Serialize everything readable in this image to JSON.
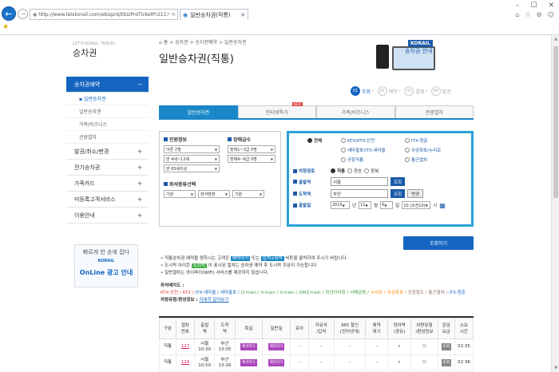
{
  "browser": {
    "url": "http://www.letskorail.com/ebizprd/EbizPrdTicketPr21111...",
    "tab_title": "일반승차권(직통)",
    "back": "←",
    "forward": "→"
  },
  "sidebar": {
    "brand_small": "LET'S KORAIL TRAVEL",
    "title": "승차권",
    "menu": [
      {
        "label": "승차권예약",
        "active": true,
        "toggle": "−"
      },
      {
        "label": "발권/취소/변경",
        "toggle": "+"
      },
      {
        "label": "전기승차권",
        "toggle": "+"
      },
      {
        "label": "가족카드",
        "toggle": "+"
      },
      {
        "label": "미등록고객서비스",
        "toggle": "+"
      },
      {
        "label": "이용안내",
        "toggle": "+"
      }
    ],
    "submenu": [
      "▪ 일반승차권",
      "일반승차권",
      "가족/비즈니스",
      "관광열차"
    ],
    "ad": {
      "line1": "빠르게 한 손에 잡다",
      "logo": "KORAIL",
      "line2": "OnLine 광고 안내"
    }
  },
  "main": {
    "breadcrumb": "⌂  홈  >  승차권  >  승차권예약  >  일반승차권",
    "title": "일반승차권(직통)",
    "promo": {
      "logo": "KORAIL",
      "text": "승차권 안내"
    },
    "steps": [
      {
        "num": "01",
        "label": "조회",
        "active": true
      },
      {
        "num": "02",
        "label": "예약"
      },
      {
        "num": "03",
        "label": "결제"
      },
      {
        "num": "04",
        "label": "발권"
      }
    ],
    "tabs": [
      {
        "label": "일반승차권",
        "active": true
      },
      {
        "label": "인터넷특가",
        "badge": "NEW"
      },
      {
        "label": "가족/비즈니스"
      },
      {
        "label": "관광열차"
      }
    ],
    "passenger": {
      "section": "인원정보",
      "rows": [
        "어른 2명",
        "만 4세~12세",
        "만 65세이상"
      ],
      "disabled_section": "장애급수",
      "disabled_rows": [
        "장애1~3급 0명",
        "장애4~6급 0명"
      ]
    },
    "seat": {
      "section": "좌석종류선택",
      "options": [
        "기본",
        "좌석방향",
        "기본"
      ]
    },
    "train_types": [
      {
        "label": "전체",
        "selected": true
      },
      {
        "label": "KTX/KTX-산천"
      },
      {
        "label": "ITX-청춘"
      },
      {
        "label": "새마을호/ITX-새마을"
      },
      {
        "label": "무궁화호/누리로"
      },
      {
        "label": "통근열차"
      },
      {
        "label": "공항직통"
      }
    ],
    "route": {
      "label": "여정경로",
      "options": [
        {
          "label": "직통",
          "selected": true
        },
        {
          "label": "환승"
        },
        {
          "label": "왕복"
        }
      ]
    },
    "departure": {
      "label": "출발역",
      "value": "서울",
      "btn": "조회"
    },
    "arrival": {
      "label": "도착역",
      "value": "부산",
      "btn": "조회",
      "swap": "변경"
    },
    "date": {
      "label": "출발일",
      "year": "2015",
      "y_unit": "년",
      "month": "11",
      "m_unit": "월",
      "day": "6",
      "d_unit": "일",
      "hour": "10 (오전10)",
      "h_unit": "시",
      "cal": "▦"
    },
    "search_btn": "조회하기",
    "notes": [
      {
        "pre": "• 직통승차권 예약을 원하시는 고객은 ",
        "tag": "예약하기",
        "post": " 또는 ",
        "tag2": "입석+좌석",
        "post2": " 버튼을 클릭하여 주시기 바랍니다."
      },
      {
        "pre": "• 도시락 아이콘 ",
        "tag": "도시락",
        "post": " 이 표시된 열차는 승차권 예약 후 도시락 주문이 가능합니다.",
        "tag2": "",
        "post2": ""
      },
      {
        "pre": "• 일반열차는 와이파이(WiFi) 서비스를 제공하지 않습니다.",
        "tag": "",
        "post": "",
        "tag2": "",
        "post2": ""
      }
    ],
    "legend": {
      "title": "좌석배치도 :",
      "items": [
        {
          "t": "KTX-산천",
          "c": "#e53935"
        },
        {
          "t": "KTX",
          "c": "#e53935"
        },
        {
          "t": "ITX-새마을",
          "c": "#1565c0"
        },
        {
          "t": "새마을호",
          "c": "#1565c0"
        },
        {
          "t": "O-train",
          "c": "#43a047"
        },
        {
          "t": "V-train",
          "c": "#43a047"
        },
        {
          "t": "S-train",
          "c": "#43a047"
        },
        {
          "t": "DMZ train",
          "c": "#43a047"
        },
        {
          "t": "정선아리랑",
          "c": "#43a047"
        },
        {
          "t": "서해금빛",
          "c": "#43a047"
        },
        {
          "t": "누리로",
          "c": "#fb8c00"
        },
        {
          "t": "무궁화호",
          "c": "#fb8c00"
        },
        {
          "t": "공항철도",
          "c": "#8d6e63"
        },
        {
          "t": "통근열차",
          "c": "#8d6e63"
        },
        {
          "t": "ITX-청춘",
          "c": "#1565c0"
        }
      ],
      "footnote_label": "차량유형/편성정보 :",
      "footnote_link": "자세히 알아보기"
    },
    "table": {
      "headers": [
        "구분",
        "열차\n번호",
        "출발\n역",
        "도착\n역",
        "특실",
        "일반실",
        "유아",
        "자유석\n/입석",
        "365 할인\n(인터넷개)",
        "예약\n대기",
        "정차역\n(경유)",
        "차량유형\n/편성정보",
        "운임\n요금",
        "소요\n시간"
      ],
      "rows": [
        {
          "type": "직통",
          "no": "127",
          "dep": "서울",
          "dep_t": "10:30",
          "arr": "부산",
          "arr_t": "13:05",
          "first": "예약하기",
          "std": "예약하기",
          "inf": "-",
          "free": "-",
          "d365": "-",
          "wait": "-",
          "fare": "조회",
          "dur": "02:35"
        },
        {
          "type": "직통",
          "no": "129",
          "dep": "서울",
          "dep_t": "10:50",
          "arr": "부산",
          "arr_t": "13:26",
          "first": "예약하기",
          "std": "예약하기",
          "inf": "-",
          "free": "-",
          "d365": "-",
          "wait": "-",
          "fare": "조회",
          "dur": "02:36"
        }
      ]
    }
  },
  "colors": {
    "accent": "#1565c0",
    "tab_active": "#1a88c8",
    "search_border": "#2aa1d8"
  }
}
